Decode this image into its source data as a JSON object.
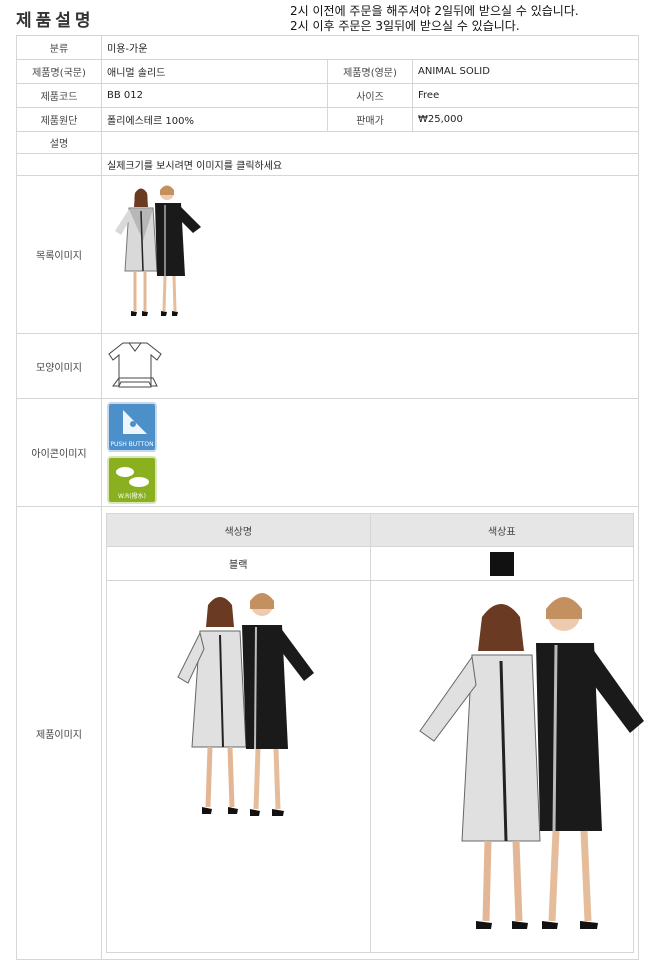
{
  "header": {
    "title": "제품설명",
    "notice_line1": "2시 이전에 주문을 해주셔야 2일뒤에 받으실 수 있습니다.",
    "notice_line2": "2시 이후 주문은 3일뒤에 받으실 수 있습니다."
  },
  "spec": {
    "category_label": "분류",
    "category_value": "미용-가운",
    "name_kr_label": "제품명(국문)",
    "name_kr_value": "애니멀 솔리드",
    "name_en_label": "제품명(영문)",
    "name_en_value": "ANIMAL SOLID",
    "code_label": "제품코드",
    "code_value": "BB 012",
    "size_label": "사이즈",
    "size_value": "Free",
    "material_label": "제품원단",
    "material_value": "폴리에스테르 100%",
    "price_label": "판매가",
    "price_value": "₩25,000",
    "desc_label": "설명",
    "click_notice": "실제크기를 보시려면 이미지를 클릭하세요",
    "list_image_label": "목록이미지",
    "shape_image_label": "모양이미지",
    "icon_image_label": "아이콘이미지",
    "product_image_label": "제품이미지"
  },
  "icons": {
    "push_button_text": "PUSH BUTTON",
    "waterproof_text": "W.R(撥水)"
  },
  "colors_table": {
    "col1_header": "색상명",
    "col2_header": "색상표",
    "color_name": "블랙",
    "color_hex": "#111111"
  }
}
